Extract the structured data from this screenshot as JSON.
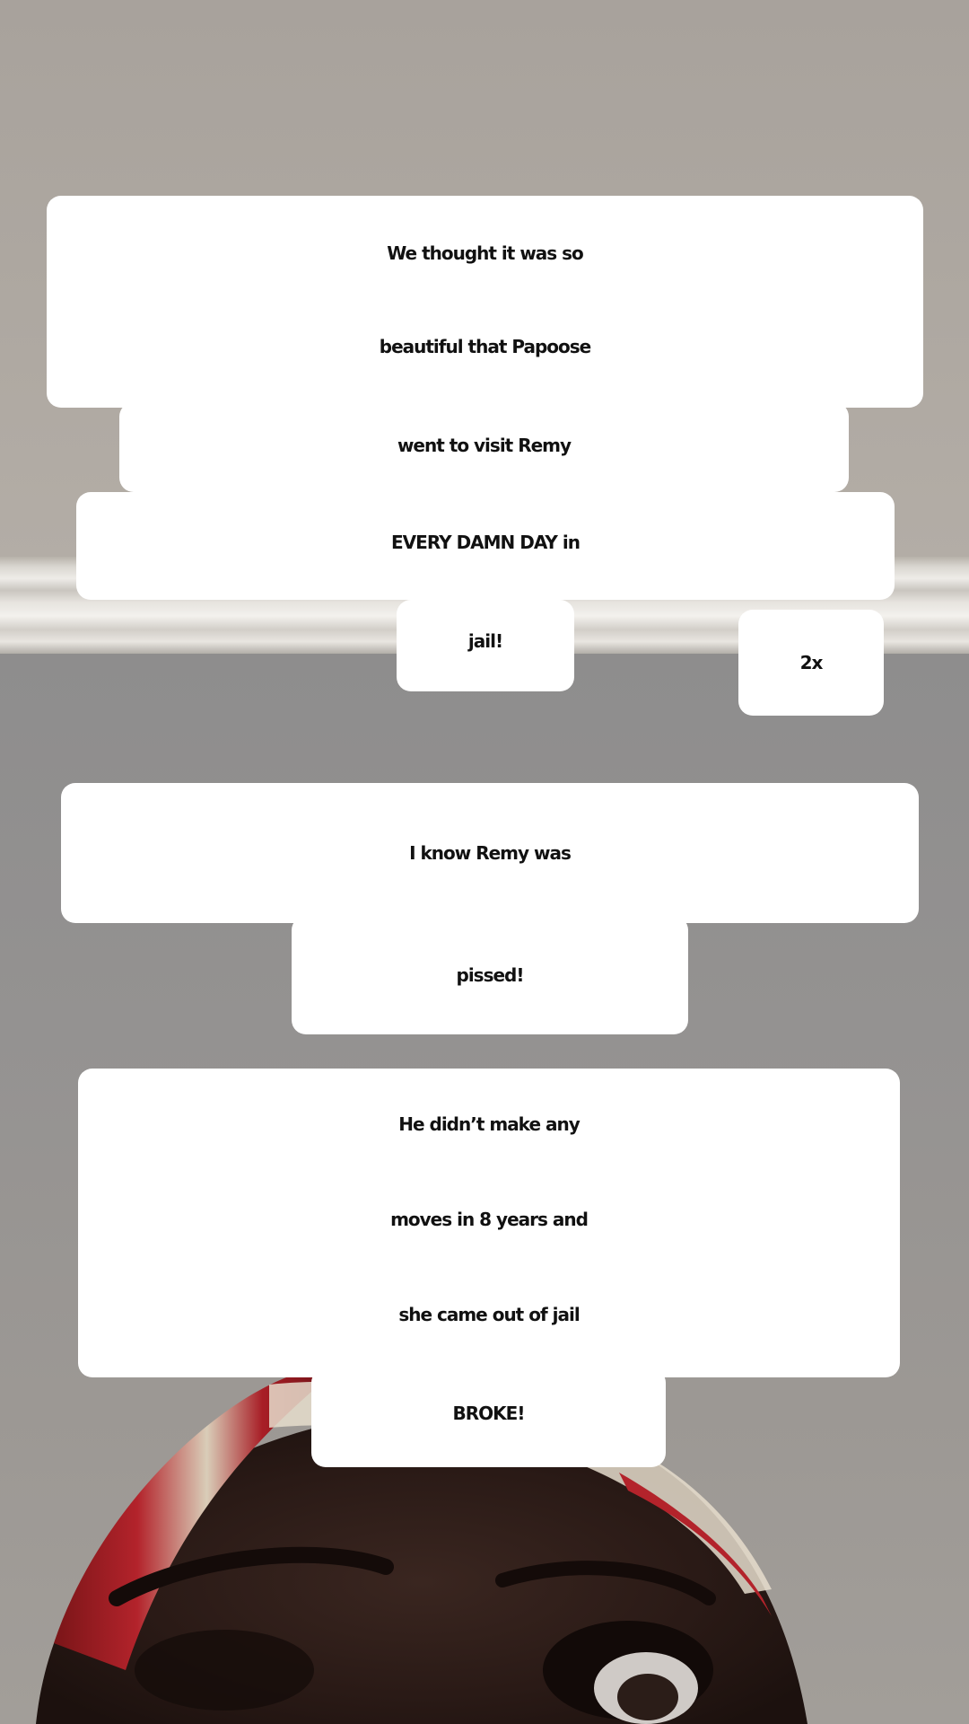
{
  "captions": {
    "first": {
      "lines": [
        "We thought it was so",
        "beautiful that Papoose",
        "went to visit Remy",
        "EVERY DAMN DAY in",
        "jail!"
      ]
    },
    "speed_badge": "2x",
    "second": {
      "lines": [
        "I know Remy was",
        "pissed!"
      ]
    },
    "third": {
      "lines": [
        "He didn’t make any",
        "moves in 8 years and",
        "she came out of jail",
        "BROKE!"
      ]
    }
  },
  "colors": {
    "caption_background": "#ffffff",
    "caption_text": "#111111",
    "headwrap_red": "#b3232b"
  }
}
